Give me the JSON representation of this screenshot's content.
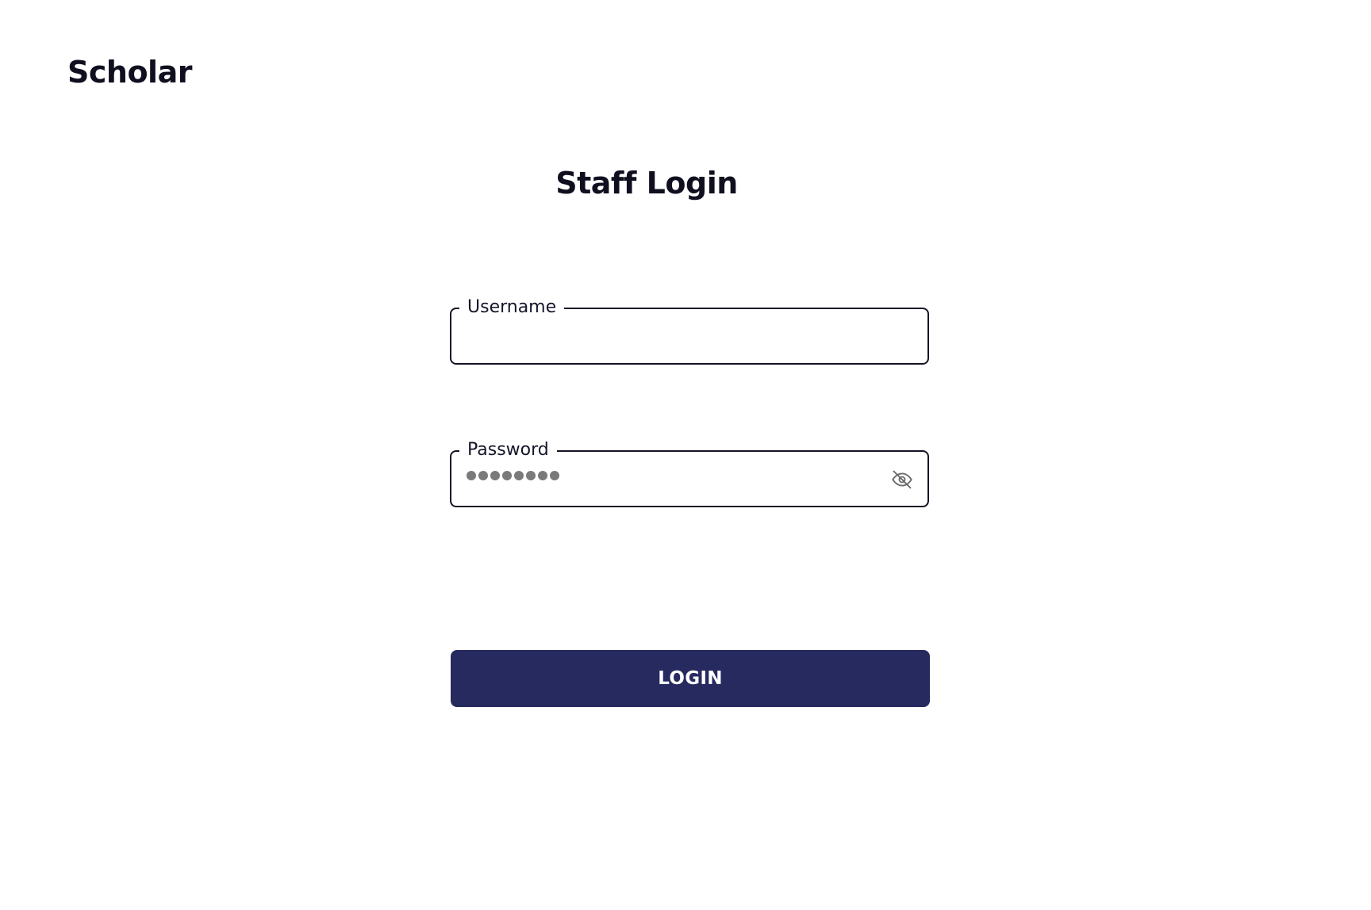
{
  "brand": {
    "name": "Scholar"
  },
  "page": {
    "title": "Staff Login"
  },
  "form": {
    "username": {
      "label": "Username",
      "value": ""
    },
    "password": {
      "label": "Password",
      "masked_length": 8,
      "visibility_icon": "eye-off-icon"
    },
    "submit_label": "LOGIN"
  },
  "colors": {
    "text": "#0f0f1f",
    "border": "#141427",
    "button_bg": "#262a5f",
    "button_text": "#ffffff",
    "mask_dot": "#7a7a7a"
  }
}
